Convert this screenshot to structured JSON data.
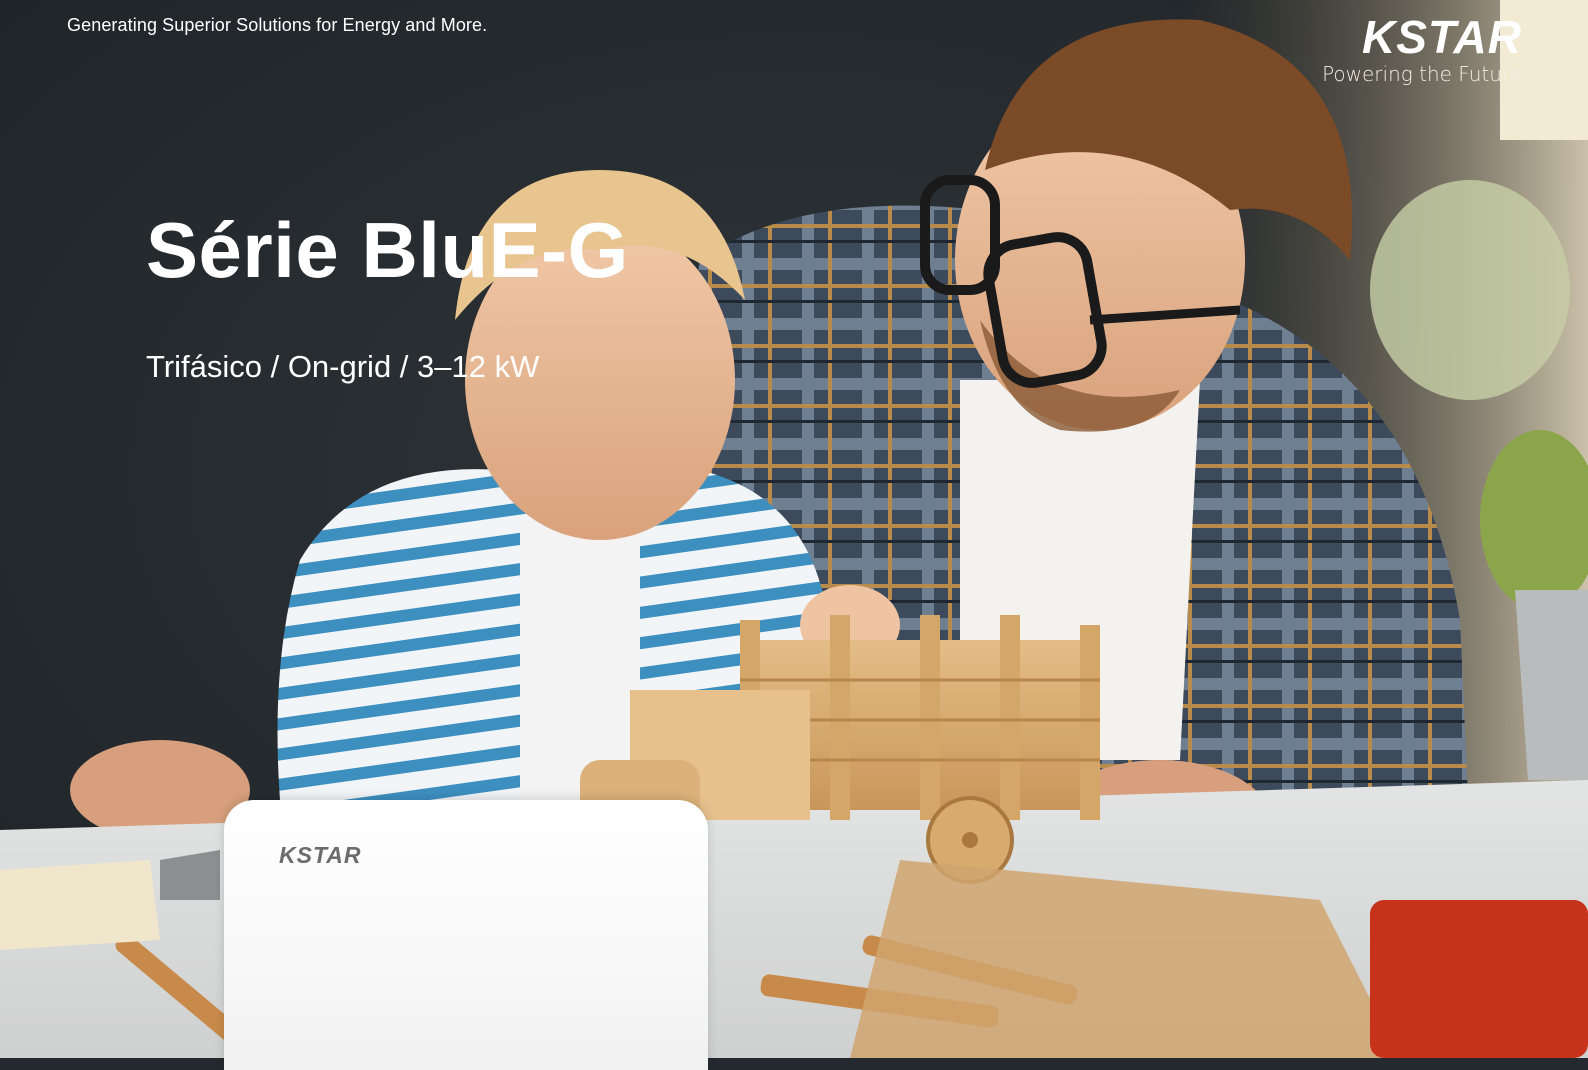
{
  "header": {
    "tagline": "Generating Superior Solutions for Energy and More.",
    "brand_logo": "KSTAR",
    "brand_slogan": "Powering the Future"
  },
  "hero": {
    "title": "Série BluE-G",
    "subtitle": "Trifásico / On-grid / 3–12 kW"
  },
  "device": {
    "logo": "KSTAR"
  },
  "colors": {
    "background_dark": "#23292e",
    "text": "#ffffff",
    "device_body": "#f7f7f7",
    "device_logo": "#6c6c6c"
  }
}
